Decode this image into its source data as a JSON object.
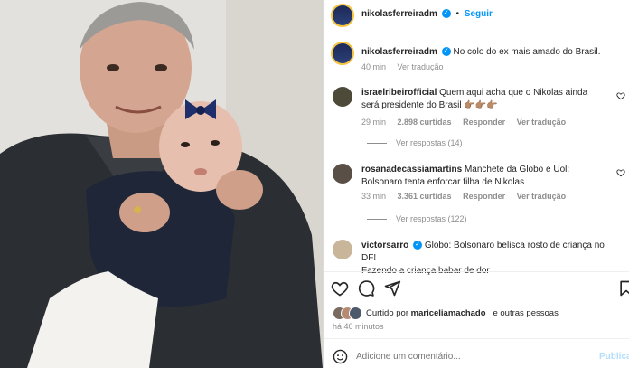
{
  "post": {
    "author": "nikolasferreiradm",
    "follow_label": "Seguir",
    "caption": "No colo do ex mais amado do Brasil.",
    "caption_time": "40 min",
    "see_translation": "Ver tradução"
  },
  "comments": [
    {
      "user": "israelribeirofficial",
      "text": "Quem aqui acha que o Nikolas ainda será presidente do Brasil 👉🏽👉🏽👉🏽",
      "time": "29 min",
      "likes": "2.898 curtidas",
      "reply": "Responder",
      "translate": "Ver tradução",
      "view_replies": "Ver respostas (14)"
    },
    {
      "user": "rosanadecassiamartins",
      "text": "Manchete da Globo e Uol: Bolsonaro tenta enforcar filha de Nikolas",
      "time": "33 min",
      "likes": "3.361 curtidas",
      "reply": "Responder",
      "translate": "Ver tradução",
      "view_replies": "Ver respostas (122)"
    },
    {
      "user": "victorsarro",
      "text_line1": "Globo: Bolsonaro belisca rosto de criança no DF!",
      "text_line2": "Fazendo a criança babar de dor"
    }
  ],
  "likes_line": {
    "prefix": "Curtido por",
    "user": "mariceliamachado_",
    "suffix": "e outras pessoas"
  },
  "post_time": "há 40 minutos",
  "comment_input": {
    "placeholder": "Adicione um comentário..."
  },
  "publish_label": "Publicar"
}
